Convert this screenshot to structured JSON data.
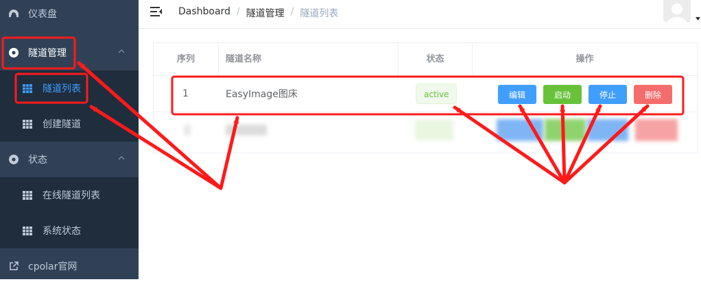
{
  "sidebar": {
    "dashboard": "仪表盘",
    "tunnel_mgmt": "隧道管理",
    "tunnel_list": "隧道列表",
    "create_tunnel": "创建隧道",
    "status": "状态",
    "online_tunnels": "在线隧道列表",
    "system_status": "系统状态",
    "cpolar_site": "cpolar官网"
  },
  "breadcrumb": [
    "Dashboard",
    "隧道管理",
    "隧道列表"
  ],
  "table": {
    "headers": [
      "序列",
      "隧道名称",
      "状态",
      "操作"
    ],
    "rows": [
      {
        "index": "1",
        "name": "EasyImage图床",
        "status": "active"
      }
    ],
    "actions": {
      "edit": "编辑",
      "start": "启动",
      "stop": "停止",
      "delete": "删除"
    }
  },
  "colors": {
    "sidebar_bg": "#304156",
    "submenu_bg": "#1f2d3d",
    "primary": "#409eff",
    "success": "#67c23a",
    "danger": "#f56c6c",
    "annotation": "#ff1a1a"
  }
}
